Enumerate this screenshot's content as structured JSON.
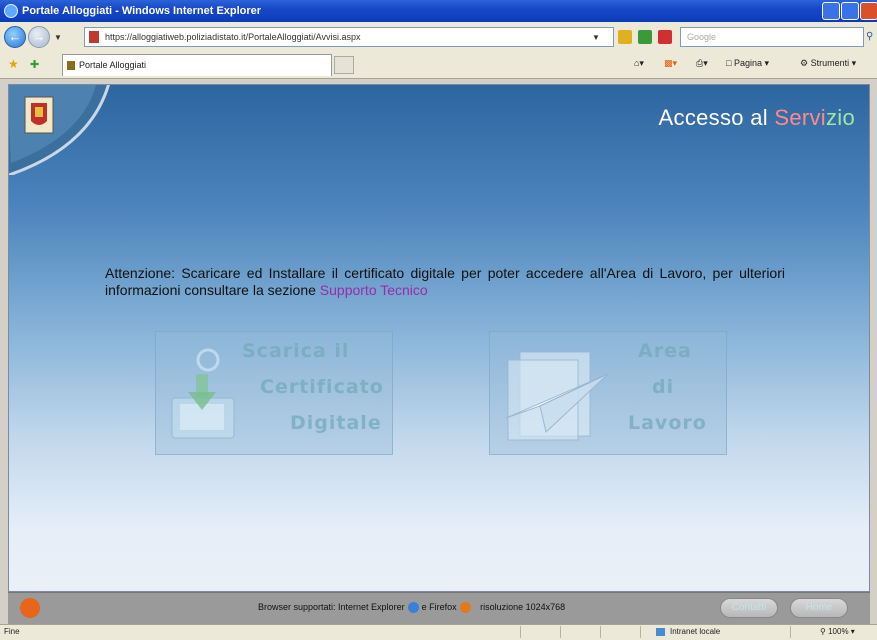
{
  "window": {
    "title": "Portale Alloggiati - Windows Internet Explorer"
  },
  "address_bar": {
    "url": "https://alloggiatiweb.poliziadistato.it/PortaleAlloggiati/Avvisi.aspx"
  },
  "search": {
    "placeholder": "Google"
  },
  "tab": {
    "title": "Portale Alloggiati"
  },
  "command_bar": {
    "page_label": "Pagina",
    "tools_label": "Strumenti"
  },
  "page": {
    "heading": {
      "part1": "Accesso al ",
      "part2": "Servi",
      "part3": "zio"
    },
    "notice": {
      "text": "Attenzione: Scaricare ed Installare il certificato digitale per poter accedere all'Area di Lavoro, per ulteriori informazioni consultare la sezione ",
      "link": "Supporto Tecnico"
    },
    "download_panel": {
      "line1": "Scarica il",
      "line2": "Certificato",
      "line3": "Digitale"
    },
    "work_panel": {
      "line1": "Area",
      "line2": "di",
      "line3": "Lavoro"
    },
    "footer": {
      "text1": "Browser supportati: Internet Explorer",
      "text2": "e Firefox",
      "text3": "risoluzione 1024x768",
      "contact_label": "Contatti",
      "home_label": "Home"
    }
  },
  "statusbar": {
    "status": "Fine",
    "zone": "Intranet locale",
    "zoom": "100%"
  },
  "colors": {
    "title_bar": "#1848c8",
    "page_top": "#2d65a0",
    "link": "#9a2ca8",
    "heading_green": "#9fe6a6",
    "heading_red": "#ff8a8a"
  }
}
